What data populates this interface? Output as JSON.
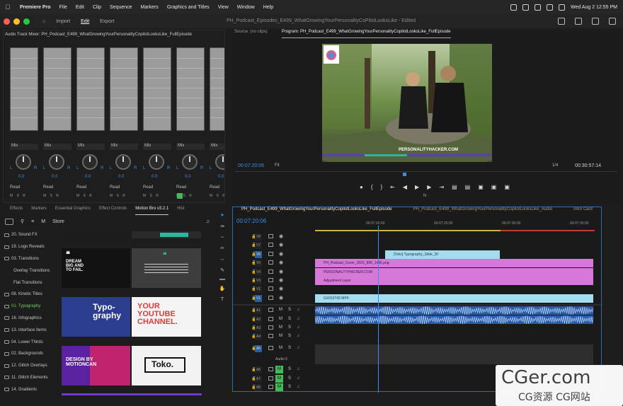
{
  "menubar": {
    "app": "Premiere Pro",
    "items": [
      "File",
      "Edit",
      "Clip",
      "Sequence",
      "Markers",
      "Graphics and Titles",
      "View",
      "Window",
      "Help"
    ],
    "clock": "Wed Aug 2  12:55 PM"
  },
  "appbar": {
    "nav": [
      "Import",
      "Edit",
      "Export"
    ],
    "active": "Edit",
    "title": "PH_Podcast_Episodes_E499_WhatGrowingYourPersonalityCoPilotLooksLike - Edited"
  },
  "mixer": {
    "title": "Audio Track Mixer: PH_Podcast_E499_WhatGrowingYourPersonalityCopilotLooksLike_FullEpisode",
    "mix_label": "Mix",
    "read_label": "Read",
    "knob_value": "0.0",
    "left": "L",
    "right": "R",
    "strip_buttons": "M S R"
  },
  "program": {
    "tabs": [
      "Source: (no clips)",
      "Program: PH_Podcast_E499_WhatGrowingYourPersonalityCopilotLooksLike_FullEpisode"
    ],
    "timecode": "00:07:20:06",
    "fit": "Fit",
    "resolution": "1/4",
    "duration": "00:30:57:14",
    "video_caption": "PERSONALITYHACKER.COM",
    "fx": "fx"
  },
  "effects_tabs": [
    "Effects",
    "Markers",
    "Essential Graphics",
    "Effect Controls",
    "Motion Bro v3.2.1",
    "Hist"
  ],
  "effects_tab_active": "Motion Bro v3.2.1",
  "store_label": "Store",
  "motionbro": {
    "categories": [
      {
        "label": "20. Sound FX",
        "sub": false,
        "sel": false
      },
      {
        "label": "19. Logo Reveals",
        "sub": false,
        "sel": false
      },
      {
        "label": "03. Transitions",
        "sub": false,
        "sel": false
      },
      {
        "label": "Overlay Transitions",
        "sub": true,
        "sel": false
      },
      {
        "label": "Flat Transitions",
        "sub": true,
        "sel": false
      },
      {
        "label": "08. Kinetic Titles",
        "sub": false,
        "sel": false
      },
      {
        "label": "01. Typography",
        "sub": false,
        "sel": true
      },
      {
        "label": "16. Infographics",
        "sub": false,
        "sel": false
      },
      {
        "label": "13. Interface Items",
        "sub": false,
        "sel": false
      },
      {
        "label": "04. Lower Thirds",
        "sub": false,
        "sel": false
      },
      {
        "label": "02. Backgrounds",
        "sub": false,
        "sel": false
      },
      {
        "label": "12. Glitch Overlays",
        "sub": false,
        "sel": false
      },
      {
        "label": "11. Glitch Elements",
        "sub": false,
        "sel": false
      },
      {
        "label": "14. Gradients",
        "sub": false,
        "sel": false
      }
    ],
    "thumbs": {
      "dream": "DREAM BIG AND TO FAIL.",
      "typography": "Typo-graphy",
      "youtube": "YOUR YOUTUBE CHANNEL.",
      "design": "DESIGN BY MOTIONCAN",
      "toko": "Toko."
    }
  },
  "timeline": {
    "tabs": [
      "PH_Podcast_E499_WhatGrowingYourPersonalityCopilotLooksLike_FullEpisode",
      "PH_Podcast_E499_WhatGrowingYourPersonalityCopilotLooksLike_Audio",
      "Intro Card"
    ],
    "timecode": "00:07:20:06",
    "ruler": [
      "00:07:20:00",
      "00:07:25:00",
      "00:07:30:00",
      "00:07:35:00"
    ],
    "video_tracks": [
      "V8",
      "V7",
      "V6",
      "V5",
      "V4",
      "V3",
      "V2",
      "V1"
    ],
    "audio_tracks": [
      "A1",
      "A2",
      "A3",
      "A4",
      "A5",
      "A6",
      "A7",
      "A8"
    ],
    "audio5_name": "Audio 5",
    "clips": {
      "typography": "[Toko] Typography_Slide_20",
      "cover": "PH_Podcast_Cover_2022_896_1496.png",
      "ph": "PERSONALITYHACKER.COM",
      "adjust": "Adjustment Layer",
      "gx": "GX010742.MP4"
    }
  },
  "watermark": {
    "big": "CGer.com",
    "small": "CG资源  CG网站"
  },
  "colors": {
    "accent": "#3a8ee6",
    "clip_pink": "#d678d8",
    "clip_blue": "#a3dcef",
    "audio_clip": "#2a5aa8",
    "selected_category": "#6fd15a"
  }
}
